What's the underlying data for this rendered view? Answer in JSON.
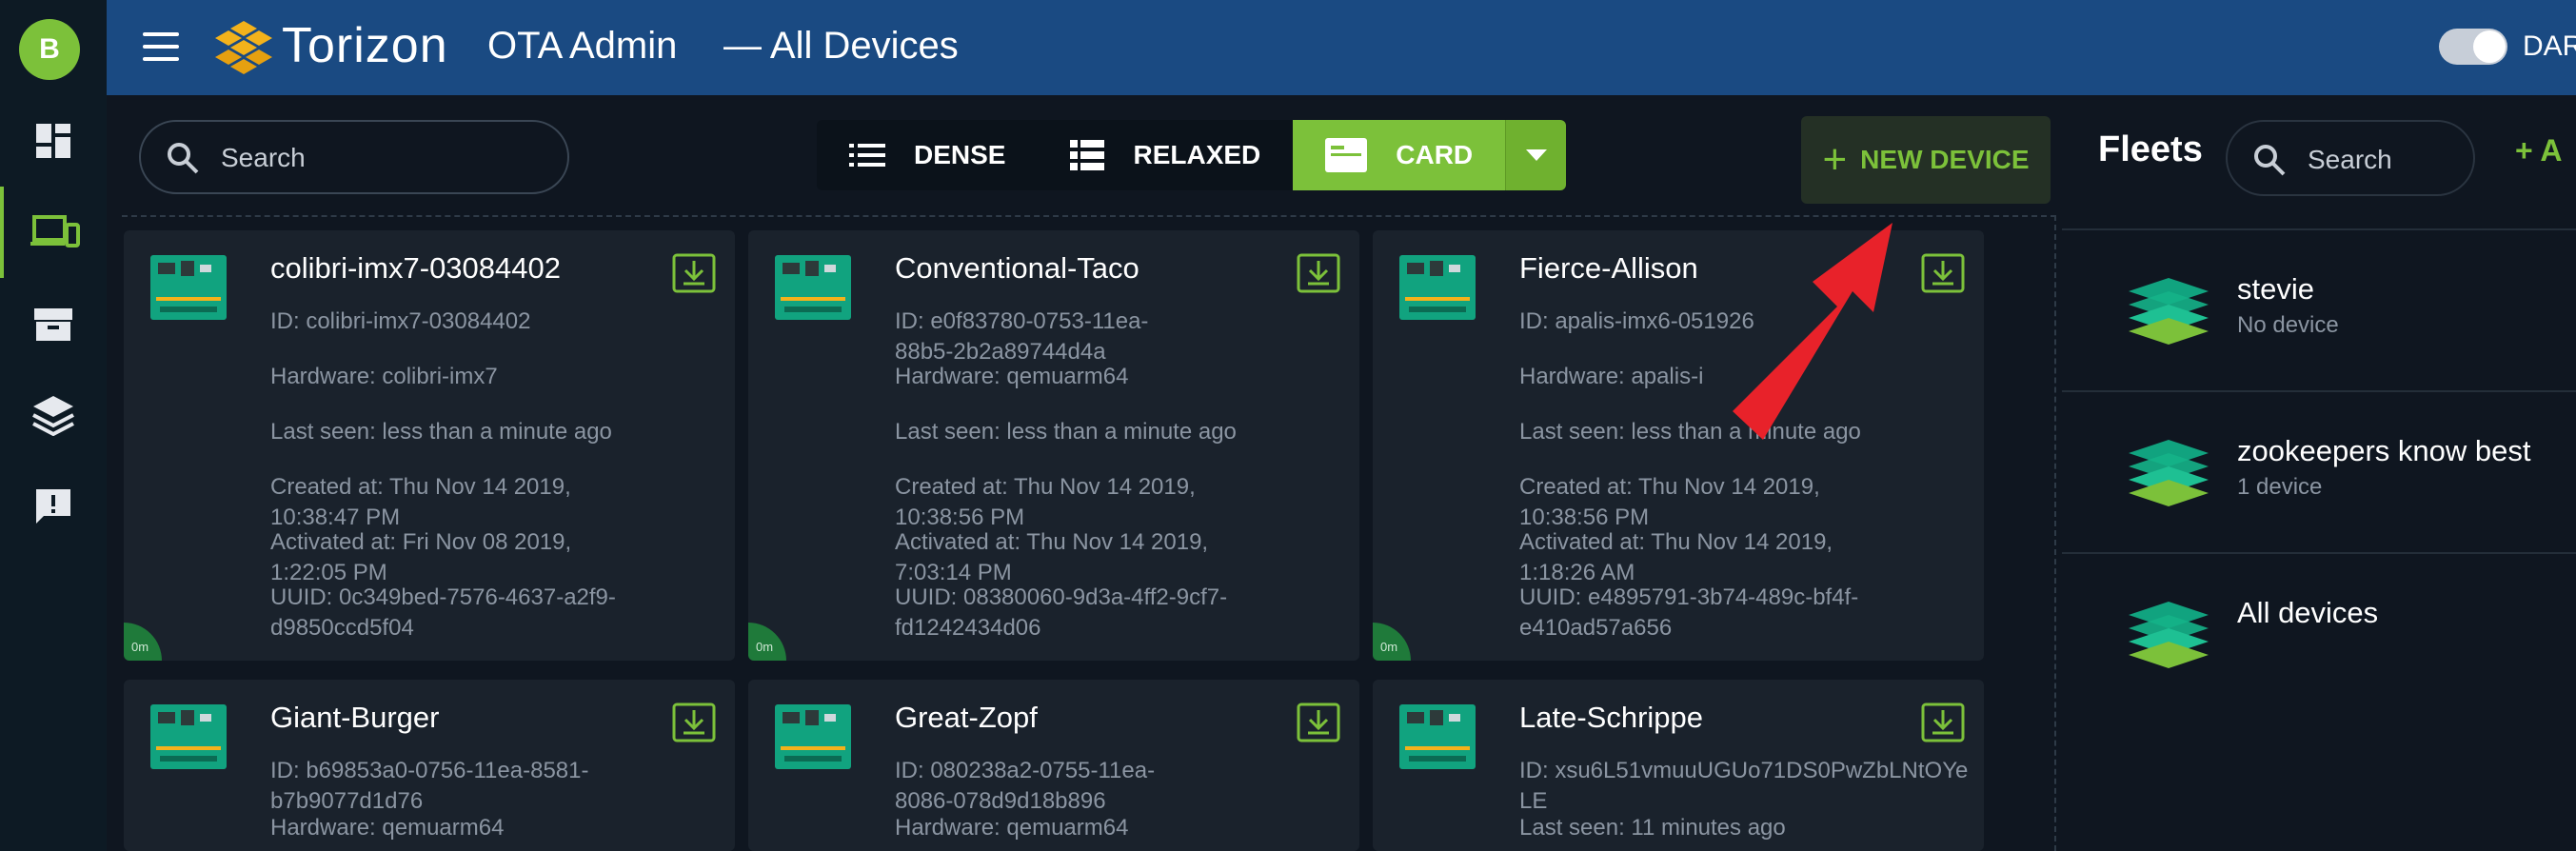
{
  "header": {
    "avatar_letter": "B",
    "brand": "Torizon",
    "product": "OTA Admin",
    "page": "— All Devices",
    "dark_mode_label": "DAR",
    "dark_mode_on": true
  },
  "nav": {
    "items": [
      "dashboard-icon",
      "devices-icon",
      "packages-icon",
      "fleets-icon",
      "feedback-icon"
    ],
    "active": "devices-icon"
  },
  "toolbar": {
    "search_placeholder": "Search",
    "views": {
      "dense": "DENSE",
      "relaxed": "RELAXED",
      "card": "CARD"
    },
    "selected_view": "CARD",
    "new_device": "NEW DEVICE"
  },
  "devices": [
    {
      "name": "colibri-imx7-03084402",
      "id": "ID: colibri-imx7-03084402",
      "hardware": "Hardware: colibri-imx7",
      "last_seen": "Last seen: less than a minute ago",
      "created": "Created at: Thu Nov 14 2019, 10:38:47 PM",
      "activated": "Activated at: Fri Nov 08 2019, 1:22:05 PM",
      "uuid": "UUID: 0c349bed-7576-4637-a2f9-d9850ccd5f04",
      "age": "0m"
    },
    {
      "name": "Conventional-Taco",
      "id": "ID: e0f83780-0753-11ea-88b5-2b2a89744d4a",
      "hardware": "Hardware: qemuarm64",
      "last_seen": "Last seen: less than a minute ago",
      "created": "Created at: Thu Nov 14 2019, 10:38:56 PM",
      "activated": "Activated at: Thu Nov 14 2019, 7:03:14 PM",
      "uuid": "UUID: 08380060-9d3a-4ff2-9cf7-fd1242434d06",
      "age": "0m"
    },
    {
      "name": "Fierce-Allison",
      "id": "ID: apalis-imx6-051926",
      "hardware": "Hardware: apalis-i",
      "last_seen": "Last seen: less than a minute ago",
      "created": "Created at: Thu Nov 14 2019, 10:38:56 PM",
      "activated": "Activated at: Thu Nov 14 2019, 1:18:26 AM",
      "uuid": "UUID: e4895791-3b74-489c-bf4f-e410ad57a656",
      "age": "0m"
    },
    {
      "name": "Giant-Burger",
      "id": "ID: b69853a0-0756-11ea-8581-b7b9077d1d76",
      "hardware": "Hardware: qemuarm64"
    },
    {
      "name": "Great-Zopf",
      "id": "ID: 080238a2-0755-11ea-8086-078d9d18b896",
      "hardware": "Hardware: qemuarm64"
    },
    {
      "name": "Late-Schrippe",
      "id": "ID: xsu6L51vmuuUGUo71DS0PwZbLNtOYeLE",
      "last_seen": "Last seen: 11 minutes ago"
    }
  ],
  "fleets": {
    "title": "Fleets",
    "search_placeholder": "Search",
    "add_label": "+ A",
    "items": [
      {
        "name": "stevie",
        "count": "No device"
      },
      {
        "name": "zookeepers know best",
        "count": "1 device"
      },
      {
        "name": "All devices",
        "count": ""
      }
    ]
  },
  "colors": {
    "accent": "#7cc13a",
    "header": "#1a4a82",
    "background": "#0f1620",
    "card": "#1a222c",
    "annotation_arrow": "#e8222a"
  }
}
